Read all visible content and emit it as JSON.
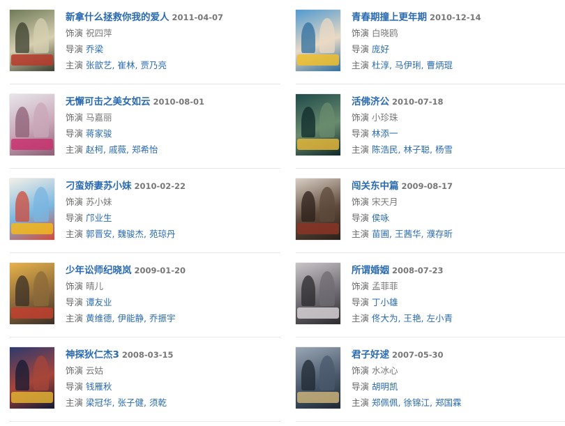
{
  "labels": {
    "role": "饰演",
    "director": "导演",
    "cast": "主演"
  },
  "items": [
    {
      "title": "新拿什么拯救你我的爱人",
      "date": "2011-04-07",
      "role": "祝四萍",
      "director": "乔梁",
      "cast": [
        "张歆艺",
        "崔林",
        "贾乃亮"
      ],
      "poster_colors": [
        "#6f7a58",
        "#d6cfb0",
        "#3b3f2e",
        "#b63a2a"
      ]
    },
    {
      "title": "青春期撞上更年期",
      "date": "2010-12-14",
      "role": "白晓鸥",
      "director": "庞好",
      "cast": [
        "杜淳",
        "马伊琍",
        "曹炳琨"
      ],
      "poster_colors": [
        "#4f9ad0",
        "#e9d9c4",
        "#2f6f9f",
        "#f0c02e"
      ]
    },
    {
      "title": "无懈可击之美女如云",
      "date": "2010-08-01",
      "role": "马嘉丽",
      "director": "蒋家骏",
      "cast": [
        "赵柯",
        "戚薇",
        "郑希怡"
      ],
      "poster_colors": [
        "#e7e5ea",
        "#c9a7b8",
        "#8c5f76",
        "#c8326e"
      ]
    },
    {
      "title": "活佛济公",
      "date": "2010-07-18",
      "role": "小珍珠",
      "director": "林添一",
      "cast": [
        "陈浩民",
        "林子聪",
        "杨雪"
      ],
      "poster_colors": [
        "#1f4a4a",
        "#6a8b6e",
        "#0f2a2a",
        "#e0b43a"
      ]
    },
    {
      "title": "刁蛮娇妻苏小妹",
      "date": "2010-02-22",
      "role": "苏小妹",
      "director": "邝业生",
      "cast": [
        "郭晋安",
        "魏骏杰",
        "苑琼丹"
      ],
      "poster_colors": [
        "#f2efe6",
        "#7ab6e0",
        "#d04a3a",
        "#f2b81e"
      ]
    },
    {
      "title": "闯关东中篇",
      "date": "2009-08-17",
      "role": "宋天月",
      "director": "侯咏",
      "cast": [
        "苗圃",
        "王茜华",
        "濮存昕"
      ],
      "poster_colors": [
        "#d9cfc3",
        "#5e4a3c",
        "#2b2019",
        "#8a3424"
      ]
    },
    {
      "title": "少年讼师纪晓岚",
      "date": "2009-01-20",
      "role": "晴儿",
      "director": "谭友业",
      "cast": [
        "黄维德",
        "伊能静",
        "乔振宇"
      ],
      "poster_colors": [
        "#e6b24a",
        "#8c6a3a",
        "#3a2f25",
        "#c2402f"
      ]
    },
    {
      "title": "所谓婚姻",
      "date": "2008-07-23",
      "role": "孟菲菲",
      "director": "丁小雄",
      "cast": [
        "佟大为",
        "王艳",
        "左小青"
      ],
      "poster_colors": [
        "#c9c4c8",
        "#6f6b72",
        "#2c2a2e",
        "#d6d0d4"
      ]
    },
    {
      "title": "神探狄仁杰3",
      "date": "2008-03-15",
      "role": "云姑",
      "director": "钱雁秋",
      "cast": [
        "梁冠华",
        "张子健",
        "须乾"
      ],
      "poster_colors": [
        "#2d3a6e",
        "#a7453a",
        "#141a33",
        "#e0b032"
      ]
    },
    {
      "title": "君子好逑",
      "date": "2007-05-30",
      "role": "水冰心",
      "director": "胡明凯",
      "cast": [
        "郑佩佩",
        "徐锦江",
        "郑国霖"
      ],
      "poster_colors": [
        "#9aa6b4",
        "#4a5a6c",
        "#1f2833",
        "#c9b27a"
      ]
    }
  ]
}
